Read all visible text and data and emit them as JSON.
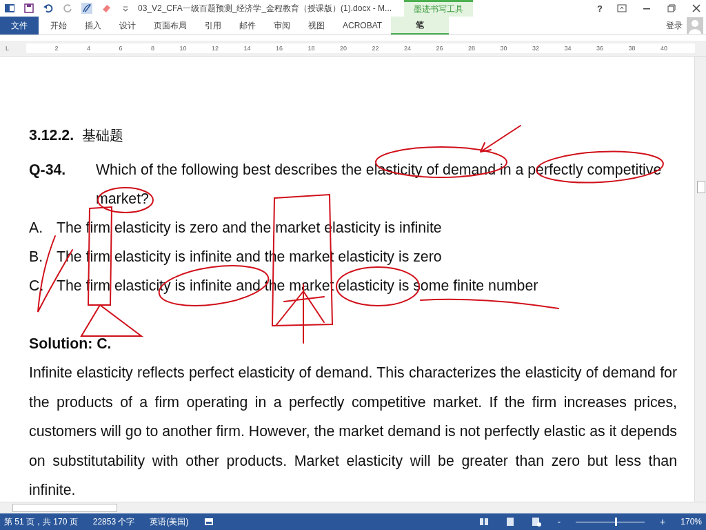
{
  "title_bar": {
    "title": "03_V2_CFA一级百题预测_经济学_金程教育（授课版）(1).docx - M...",
    "context_group": "墨迹书写工具",
    "help": "?"
  },
  "ribbon": {
    "tabs": [
      {
        "label": "文件",
        "kind": "file",
        "selected": false
      },
      {
        "label": "开始",
        "kind": "tab",
        "selected": false
      },
      {
        "label": "插入",
        "kind": "tab",
        "selected": false
      },
      {
        "label": "设计",
        "kind": "tab",
        "selected": false
      },
      {
        "label": "页面布局",
        "kind": "tab",
        "selected": false
      },
      {
        "label": "引用",
        "kind": "tab",
        "selected": false
      },
      {
        "label": "邮件",
        "kind": "tab",
        "selected": false
      },
      {
        "label": "审阅",
        "kind": "tab",
        "selected": false
      },
      {
        "label": "视图",
        "kind": "tab",
        "selected": false
      },
      {
        "label": "ACROBAT",
        "kind": "tab",
        "selected": false
      },
      {
        "label": "笔",
        "kind": "context",
        "selected": true
      }
    ],
    "sign_in": "登录"
  },
  "ruler": {
    "tab_selector": "L",
    "numbers": [
      "2",
      "4",
      "6",
      "8",
      "10",
      "12",
      "14",
      "16",
      "18",
      "20",
      "22",
      "24",
      "26",
      "28",
      "30",
      "32",
      "34",
      "36",
      "38",
      "40"
    ]
  },
  "document": {
    "section_number": "3.12.2.",
    "section_title": "基础题",
    "question": {
      "number": "Q-34.",
      "text": "Which of the following best describes the elasticity of demand in a perfectly competitive market?",
      "options": [
        {
          "letter": "A.",
          "text": "The firm elasticity is zero and the market elasticity is infinite"
        },
        {
          "letter": "B.",
          "text": "The firm elasticity is infinite and the market elasticity is zero"
        },
        {
          "letter": "C.",
          "text": "The firm elasticity is infinite and the market elasticity is some finite number"
        }
      ]
    },
    "solution_label": "Solution: C.",
    "explanation": "Infinite elasticity reflects perfect elasticity of demand. This characterizes the elasticity of demand for the products of a firm operating in a perfectly competitive market. If the firm increases prices, customers will go to another firm. However, the market demand is not perfectly elastic as it depends on substitutability with other products. Market elasticity will be greater than zero but less than infinite."
  },
  "status_bar": {
    "page": "第 51 页，共 170 页",
    "words": "22853 个字",
    "language": "英语(美国)",
    "zoom_minus": "-",
    "zoom_plus": "+",
    "zoom": {
      "level": 0.58
    },
    "zoom_reading": "170%"
  }
}
